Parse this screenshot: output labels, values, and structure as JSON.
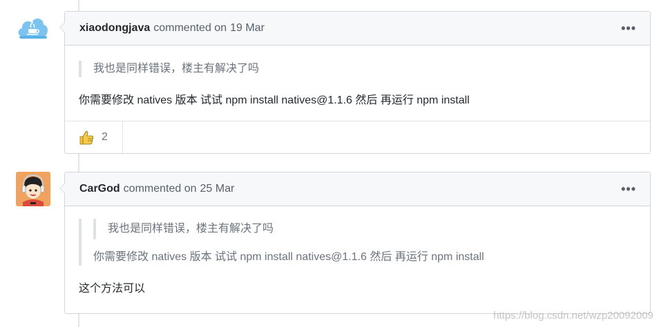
{
  "comments": [
    {
      "author": "xiaodongjava",
      "commented_label": "commented on",
      "date": "19 Mar",
      "more_label": "•••",
      "quote_lines": [
        "我也是同样错误，楼主有解决了吗"
      ],
      "body": "你需要修改 natives 版本 试试 npm install natives@1.1.6 然后 再运行 npm install",
      "reaction": {
        "icon": "thumbs-up-icon",
        "count": "2"
      }
    },
    {
      "author": "CarGod",
      "commented_label": "commented on",
      "date": "25 Mar",
      "more_label": "•••",
      "quote_nested": "我也是同样错误，楼主有解决了吗",
      "quote_outer": "你需要修改 natives 版本 试试 npm install natives@1.1.6 然后 再运行 npm install",
      "body": "这个方法可以"
    }
  ],
  "watermark": "https://blog.csdn.net/wzp20092009"
}
